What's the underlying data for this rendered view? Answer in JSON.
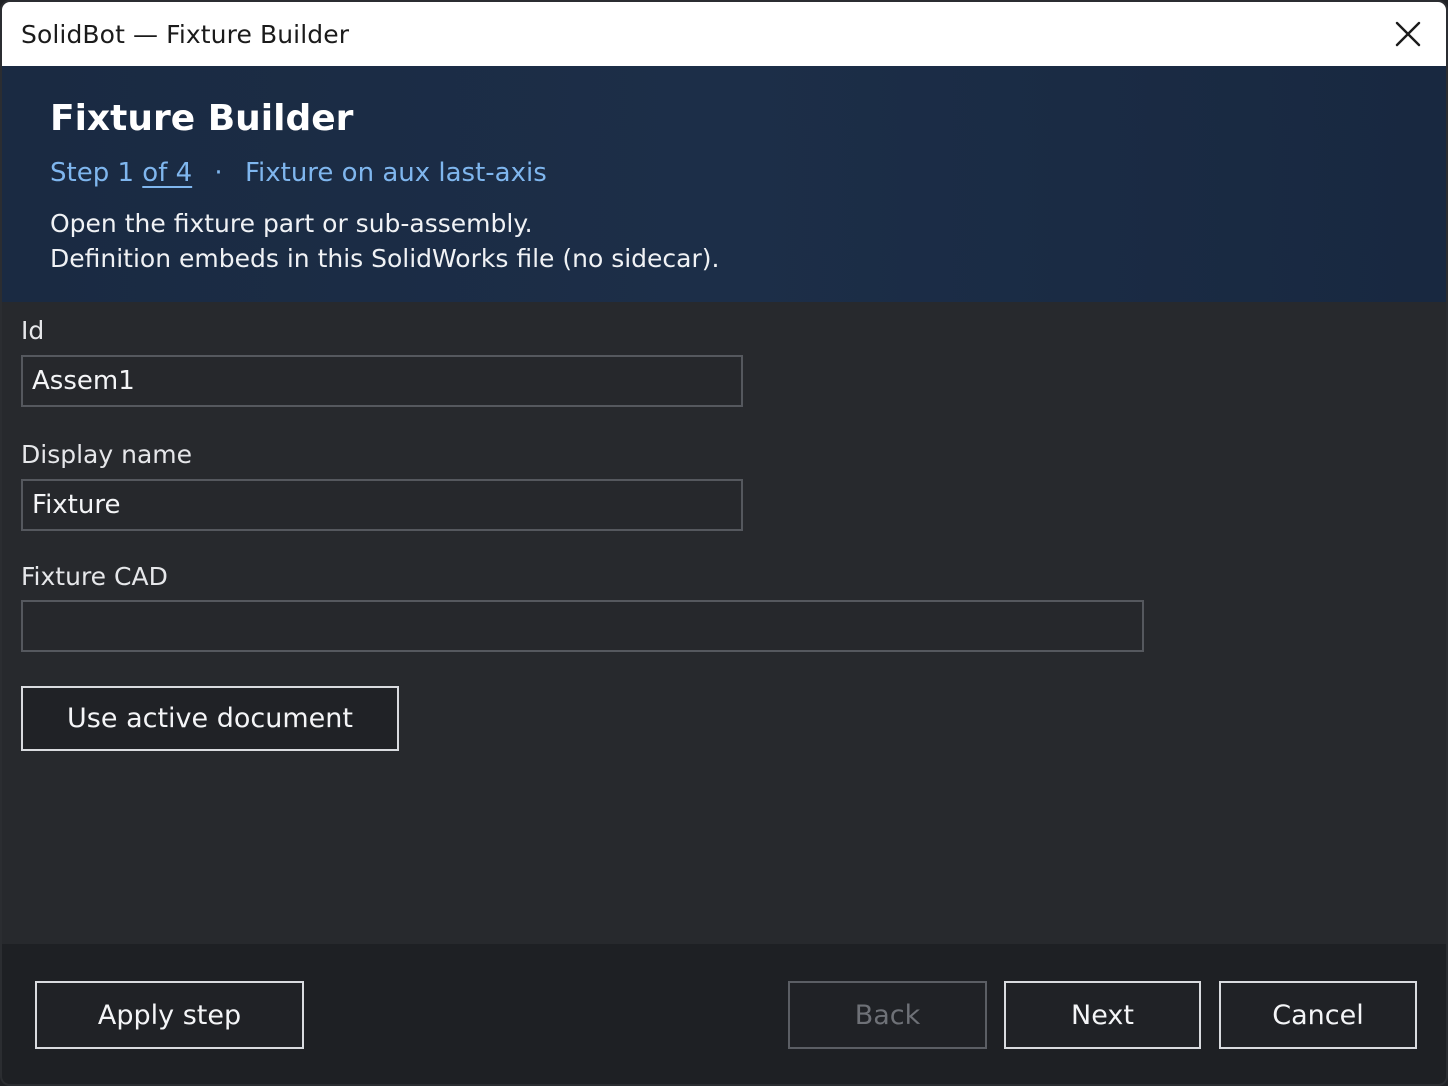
{
  "window": {
    "title": "SolidBot — Fixture Builder"
  },
  "header": {
    "title": "Fixture Builder",
    "step_prefix": "Step 1",
    "step_of": "of 4",
    "step_separator": "·",
    "step_name": "Fixture on aux last-axis",
    "description_line1": "Open the fixture part or sub-assembly.",
    "description_line2": "Definition embeds in this SolidWorks file (no sidecar)."
  },
  "form": {
    "id_label": "Id",
    "id_value": "Assem1",
    "display_name_label": "Display name",
    "display_name_value": "Fixture",
    "fixture_cad_label": "Fixture CAD",
    "fixture_cad_value": "",
    "use_active_label": "Use active document"
  },
  "footer": {
    "apply_label": "Apply step",
    "back_label": "Back",
    "next_label": "Next",
    "cancel_label": "Cancel"
  },
  "colors": {
    "header_bg": "#1c2e48",
    "accent_link": "#7fb6ee",
    "body_bg": "#27292d",
    "footer_bg": "#1e2024"
  }
}
